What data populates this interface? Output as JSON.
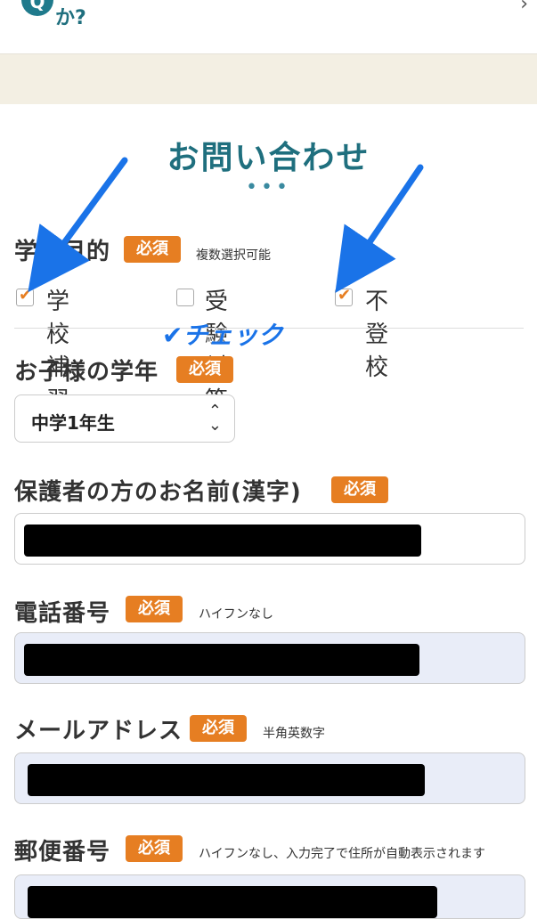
{
  "faq": {
    "text": "か?",
    "q_icon": "Q",
    "chevron": "›"
  },
  "form": {
    "title": "お問い合わせ",
    "dots": "•••",
    "required": "必須",
    "purpose": {
      "label": "学習目的",
      "hint": "複数選択可能",
      "options": [
        {
          "label": "学校補習",
          "checked": true
        },
        {
          "label": "受験対策",
          "checked": false
        },
        {
          "label": "不登校",
          "checked": true
        }
      ]
    },
    "grade": {
      "label": "お子様の学年",
      "value": "中学1年生"
    },
    "parent_name": {
      "label": "保護者の方のお名前(漢字)"
    },
    "phone": {
      "label": "電話番号",
      "hint": "ハイフンなし"
    },
    "email": {
      "label": "メールアドレス",
      "hint": "半角英数字"
    },
    "postal": {
      "label": "郵便番号",
      "hint": "ハイフンなし、入力完了で住所が自動表示されます"
    }
  },
  "annotation": {
    "text": "✔チェック",
    "color": "#1a73e8"
  },
  "colors": {
    "accent": "#e67e22",
    "title": "#1f6f7e",
    "field_blue": "#e9edf8"
  }
}
